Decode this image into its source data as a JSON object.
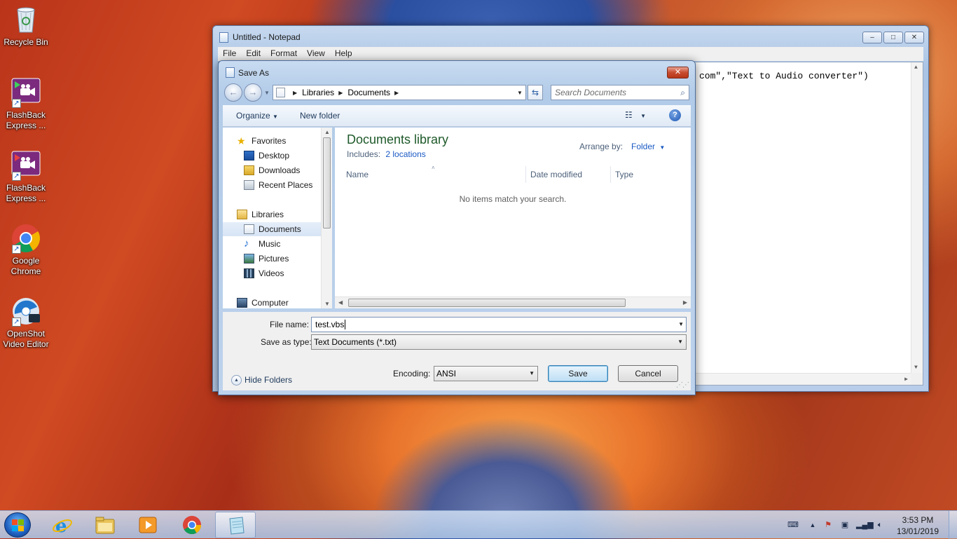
{
  "desktop": {
    "icons": [
      {
        "label": "Recycle Bin",
        "icon": "recycle-bin-icon"
      },
      {
        "label": "FlashBack Express ...",
        "icon": "flashback-express-icon"
      },
      {
        "label": "FlashBack Express ...",
        "icon": "flashback-express-icon"
      },
      {
        "label": "Google Chrome",
        "icon": "chrome-icon"
      },
      {
        "label": "OpenShot Video Editor",
        "icon": "openshot-icon"
      }
    ]
  },
  "notepad": {
    "title": "Untitled - Notepad",
    "menu": [
      "File",
      "Edit",
      "Format",
      "View",
      "Help"
    ],
    "visible_text": "com\",\"Text to Audio converter\")",
    "buttons": {
      "minimize": "–",
      "maximize": "□",
      "close": "✕"
    }
  },
  "dialog": {
    "title": "Save As",
    "close_label": "✕",
    "address": {
      "crumbs": [
        "Libraries",
        "Documents"
      ]
    },
    "search_placeholder": "Search Documents",
    "toolbar": {
      "organize": "Organize",
      "new_folder": "New folder"
    },
    "nav": {
      "favorites": "Favorites",
      "desktop": "Desktop",
      "downloads": "Downloads",
      "recent_places": "Recent Places",
      "libraries": "Libraries",
      "documents": "Documents",
      "music": "Music",
      "pictures": "Pictures",
      "videos": "Videos",
      "computer": "Computer"
    },
    "content": {
      "library_title": "Documents library",
      "includes_label": "Includes:",
      "includes_link": "2 locations",
      "arrange_label": "Arrange by:",
      "arrange_value": "Folder",
      "columns": [
        "Name",
        "Date modified",
        "Type"
      ],
      "empty_message": "No items match your search."
    },
    "form": {
      "file_name_label": "File name:",
      "file_name_value": "test.vbs",
      "save_type_label": "Save as type:",
      "save_type_value": "Text Documents (*.txt)",
      "encoding_label": "Encoding:",
      "encoding_value": "ANSI",
      "save_button": "Save",
      "cancel_button": "Cancel",
      "hide_folders": "Hide Folders"
    }
  },
  "taskbar": {
    "apps": [
      "internet-explorer-icon",
      "file-explorer-icon",
      "media-player-icon",
      "chrome-icon",
      "notepad-icon"
    ],
    "clock_time": "3:53 PM",
    "clock_date": "13/01/2019"
  },
  "colors": {
    "dialog_link": "#1b5ac4",
    "library_title": "#1e5a2a",
    "close_button": "#c84b2f"
  }
}
